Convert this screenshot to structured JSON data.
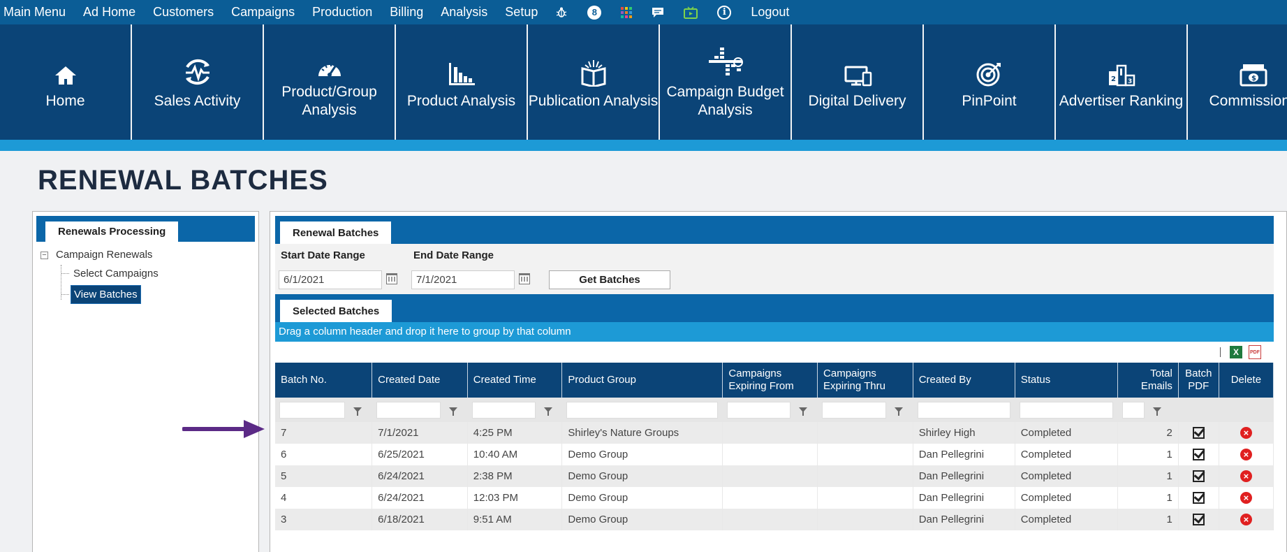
{
  "top_menu": {
    "items": [
      "Main Menu",
      "Ad Home",
      "Customers",
      "Campaigns",
      "Production",
      "Billing",
      "Analysis",
      "Setup"
    ],
    "notification_count": "8",
    "logout": "Logout"
  },
  "tiles": [
    {
      "label": "Home",
      "icon": "home-icon"
    },
    {
      "label": "Sales Activity",
      "icon": "activity-icon"
    },
    {
      "label": "Product/Group\nAnalysis",
      "icon": "gauge-icon"
    },
    {
      "label": "Product Analysis",
      "icon": "bar-chart-icon"
    },
    {
      "label": "Publication Analysis",
      "icon": "open-book-icon"
    },
    {
      "label": "Campaign Budget\nAnalysis",
      "icon": "budget-icon"
    },
    {
      "label": "Digital Delivery",
      "icon": "devices-icon"
    },
    {
      "label": "PinPoint",
      "icon": "target-icon"
    },
    {
      "label": "Advertiser Ranking",
      "icon": "podium-icon"
    },
    {
      "label": "Commissions",
      "icon": "money-icon"
    }
  ],
  "page_title": "RENEWAL BATCHES",
  "left_panel": {
    "tab": "Renewals Processing",
    "tree_root": "Campaign Renewals",
    "children": [
      "Select Campaigns",
      "View Batches"
    ],
    "selected": "View Batches"
  },
  "main_panel": {
    "tab": "Renewal Batches",
    "start_label": "Start Date Range",
    "end_label": "End Date Range",
    "start_value": "6/1/2021",
    "end_value": "7/1/2021",
    "get_button": "Get Batches",
    "selected_tab": "Selected Batches",
    "group_hint": "Drag a column header and drop it here to group by that column",
    "excel_icon": "X",
    "pdf_icon": "PDF"
  },
  "grid": {
    "columns": [
      "Batch No.",
      "Created Date",
      "Created Time",
      "Product Group",
      "Campaigns Expiring From",
      "Campaigns Expiring Thru",
      "Created By",
      "Status",
      "Total Emails",
      "Batch PDF",
      "Delete"
    ],
    "rows": [
      {
        "batch": "7",
        "date": "7/1/2021",
        "time": "4:25 PM",
        "group": "Shirley's Nature Groups",
        "from": "",
        "thru": "",
        "by": "Shirley High",
        "status": "Completed",
        "emails": "2"
      },
      {
        "batch": "6",
        "date": "6/25/2021",
        "time": "10:40 AM",
        "group": "Demo Group",
        "from": "",
        "thru": "",
        "by": "Dan Pellegrini",
        "status": "Completed",
        "emails": "1"
      },
      {
        "batch": "5",
        "date": "6/24/2021",
        "time": "2:38 PM",
        "group": "Demo Group",
        "from": "",
        "thru": "",
        "by": "Dan Pellegrini",
        "status": "Completed",
        "emails": "1"
      },
      {
        "batch": "4",
        "date": "6/24/2021",
        "time": "12:03 PM",
        "group": "Demo Group",
        "from": "",
        "thru": "",
        "by": "Dan Pellegrini",
        "status": "Completed",
        "emails": "1"
      },
      {
        "batch": "3",
        "date": "6/18/2021",
        "time": "9:51 AM",
        "group": "Demo Group",
        "from": "",
        "thru": "",
        "by": "Dan Pellegrini",
        "status": "Completed",
        "emails": "1"
      }
    ]
  },
  "colors": {
    "nav": "#0b5d96",
    "tiles": "#0b4477",
    "accent": "#1d9ad6",
    "link": "#1c7ec2",
    "arrow": "#5b2a86"
  }
}
